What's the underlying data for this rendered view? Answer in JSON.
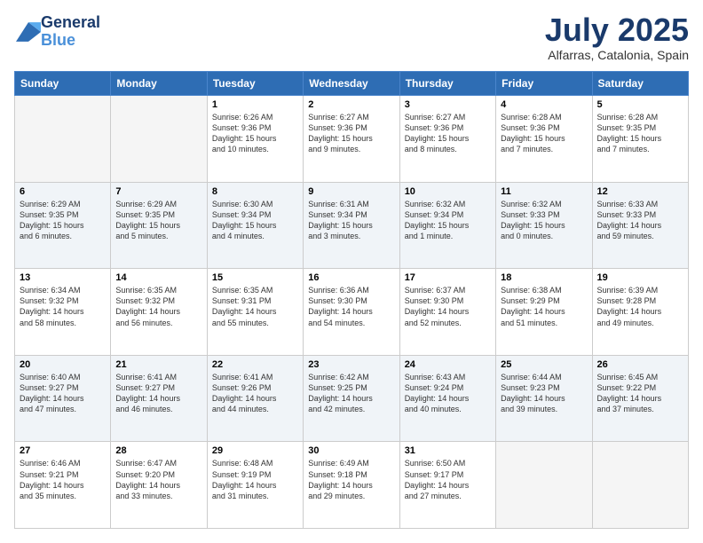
{
  "header": {
    "logo_line1": "General",
    "logo_line2": "Blue",
    "month": "July 2025",
    "location": "Alfarras, Catalonia, Spain"
  },
  "days_of_week": [
    "Sunday",
    "Monday",
    "Tuesday",
    "Wednesday",
    "Thursday",
    "Friday",
    "Saturday"
  ],
  "weeks": [
    [
      {
        "day": "",
        "text": ""
      },
      {
        "day": "",
        "text": ""
      },
      {
        "day": "1",
        "text": "Sunrise: 6:26 AM\nSunset: 9:36 PM\nDaylight: 15 hours\nand 10 minutes."
      },
      {
        "day": "2",
        "text": "Sunrise: 6:27 AM\nSunset: 9:36 PM\nDaylight: 15 hours\nand 9 minutes."
      },
      {
        "day": "3",
        "text": "Sunrise: 6:27 AM\nSunset: 9:36 PM\nDaylight: 15 hours\nand 8 minutes."
      },
      {
        "day": "4",
        "text": "Sunrise: 6:28 AM\nSunset: 9:36 PM\nDaylight: 15 hours\nand 7 minutes."
      },
      {
        "day": "5",
        "text": "Sunrise: 6:28 AM\nSunset: 9:35 PM\nDaylight: 15 hours\nand 7 minutes."
      }
    ],
    [
      {
        "day": "6",
        "text": "Sunrise: 6:29 AM\nSunset: 9:35 PM\nDaylight: 15 hours\nand 6 minutes."
      },
      {
        "day": "7",
        "text": "Sunrise: 6:29 AM\nSunset: 9:35 PM\nDaylight: 15 hours\nand 5 minutes."
      },
      {
        "day": "8",
        "text": "Sunrise: 6:30 AM\nSunset: 9:34 PM\nDaylight: 15 hours\nand 4 minutes."
      },
      {
        "day": "9",
        "text": "Sunrise: 6:31 AM\nSunset: 9:34 PM\nDaylight: 15 hours\nand 3 minutes."
      },
      {
        "day": "10",
        "text": "Sunrise: 6:32 AM\nSunset: 9:34 PM\nDaylight: 15 hours\nand 1 minute."
      },
      {
        "day": "11",
        "text": "Sunrise: 6:32 AM\nSunset: 9:33 PM\nDaylight: 15 hours\nand 0 minutes."
      },
      {
        "day": "12",
        "text": "Sunrise: 6:33 AM\nSunset: 9:33 PM\nDaylight: 14 hours\nand 59 minutes."
      }
    ],
    [
      {
        "day": "13",
        "text": "Sunrise: 6:34 AM\nSunset: 9:32 PM\nDaylight: 14 hours\nand 58 minutes."
      },
      {
        "day": "14",
        "text": "Sunrise: 6:35 AM\nSunset: 9:32 PM\nDaylight: 14 hours\nand 56 minutes."
      },
      {
        "day": "15",
        "text": "Sunrise: 6:35 AM\nSunset: 9:31 PM\nDaylight: 14 hours\nand 55 minutes."
      },
      {
        "day": "16",
        "text": "Sunrise: 6:36 AM\nSunset: 9:30 PM\nDaylight: 14 hours\nand 54 minutes."
      },
      {
        "day": "17",
        "text": "Sunrise: 6:37 AM\nSunset: 9:30 PM\nDaylight: 14 hours\nand 52 minutes."
      },
      {
        "day": "18",
        "text": "Sunrise: 6:38 AM\nSunset: 9:29 PM\nDaylight: 14 hours\nand 51 minutes."
      },
      {
        "day": "19",
        "text": "Sunrise: 6:39 AM\nSunset: 9:28 PM\nDaylight: 14 hours\nand 49 minutes."
      }
    ],
    [
      {
        "day": "20",
        "text": "Sunrise: 6:40 AM\nSunset: 9:27 PM\nDaylight: 14 hours\nand 47 minutes."
      },
      {
        "day": "21",
        "text": "Sunrise: 6:41 AM\nSunset: 9:27 PM\nDaylight: 14 hours\nand 46 minutes."
      },
      {
        "day": "22",
        "text": "Sunrise: 6:41 AM\nSunset: 9:26 PM\nDaylight: 14 hours\nand 44 minutes."
      },
      {
        "day": "23",
        "text": "Sunrise: 6:42 AM\nSunset: 9:25 PM\nDaylight: 14 hours\nand 42 minutes."
      },
      {
        "day": "24",
        "text": "Sunrise: 6:43 AM\nSunset: 9:24 PM\nDaylight: 14 hours\nand 40 minutes."
      },
      {
        "day": "25",
        "text": "Sunrise: 6:44 AM\nSunset: 9:23 PM\nDaylight: 14 hours\nand 39 minutes."
      },
      {
        "day": "26",
        "text": "Sunrise: 6:45 AM\nSunset: 9:22 PM\nDaylight: 14 hours\nand 37 minutes."
      }
    ],
    [
      {
        "day": "27",
        "text": "Sunrise: 6:46 AM\nSunset: 9:21 PM\nDaylight: 14 hours\nand 35 minutes."
      },
      {
        "day": "28",
        "text": "Sunrise: 6:47 AM\nSunset: 9:20 PM\nDaylight: 14 hours\nand 33 minutes."
      },
      {
        "day": "29",
        "text": "Sunrise: 6:48 AM\nSunset: 9:19 PM\nDaylight: 14 hours\nand 31 minutes."
      },
      {
        "day": "30",
        "text": "Sunrise: 6:49 AM\nSunset: 9:18 PM\nDaylight: 14 hours\nand 29 minutes."
      },
      {
        "day": "31",
        "text": "Sunrise: 6:50 AM\nSunset: 9:17 PM\nDaylight: 14 hours\nand 27 minutes."
      },
      {
        "day": "",
        "text": ""
      },
      {
        "day": "",
        "text": ""
      }
    ]
  ]
}
